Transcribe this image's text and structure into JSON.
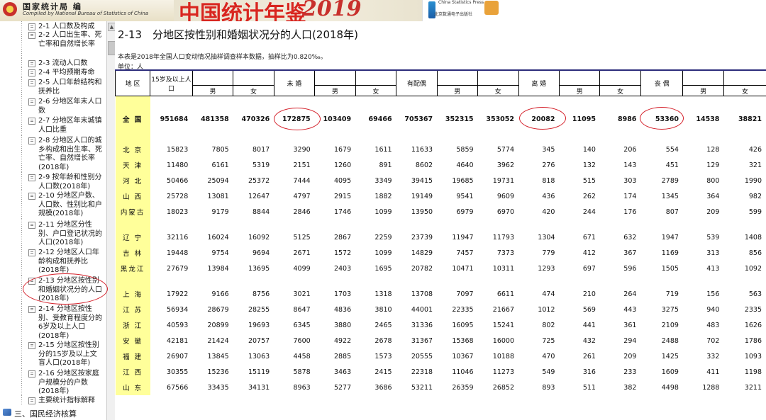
{
  "header": {
    "org_cn": "国家统计局 编",
    "org_en": "Compiled by National Bureau of Statistics of China",
    "book_title": "中国统计年鉴",
    "book_year": "2019",
    "press_en": "China Statistics Press",
    "press_cn": "北京数通电子出版社"
  },
  "sidebar": {
    "items": [
      {
        "label": "2-1 人口数及构成"
      },
      {
        "label": "2-2 人口出生率、死亡率和自然增长率"
      },
      {
        "label": "2-3 流动人口数"
      },
      {
        "label": "2-4 平均预期寿命"
      },
      {
        "label": "2-5 人口年龄结构和抚养比"
      },
      {
        "label": "2-6 分地区年末人口数"
      },
      {
        "label": "2-7 分地区年末城镇人口比重"
      },
      {
        "label": "2-8 分地区人口的城乡构成和出生率、死亡率、自然增长率(2018年)"
      },
      {
        "label": "2-9 按年龄和性别分人口数(2018年)"
      },
      {
        "label": "2-10 分地区户数、人口数、性别比和户规模(2018年)"
      },
      {
        "label": "2-11 分地区分性别、户口登记状况的人口(2018年)"
      },
      {
        "label": "2-12 分地区人口年龄构成和抚养比(2018年)"
      },
      {
        "label": "2-13 分地区按性别和婚姻状况分的人口(2018年)"
      },
      {
        "label": "2-14 分地区按性别、受教育程度分的6岁及以上人口(2018年)"
      },
      {
        "label": "2-15 分地区按性别分的15岁及以上文盲人口(2018年)"
      },
      {
        "label": "2-16 分地区按家庭户规模分的户数(2018年)"
      },
      {
        "label": "主要统计指标解释"
      }
    ],
    "footer": "三、国民经济核算"
  },
  "main": {
    "title": "2-13　分地区按性别和婚姻状况分的人口(2018年)",
    "note": "本表是2018年全国人口变动情况抽样调查样本数据，抽样比为0.820‰。",
    "unit": "单位：人",
    "headers": {
      "region": "地 区",
      "pop15": "15岁及以上人口",
      "unmarried": "未 婚",
      "married": "有配偶",
      "divorced": "离 婚",
      "widowed": "丧 偶",
      "male": "男",
      "female": "女"
    },
    "total": {
      "region": "全 国",
      "values": [
        "951684",
        "481358",
        "470326",
        "172875",
        "103409",
        "69466",
        "705367",
        "352315",
        "353052",
        "20082",
        "11095",
        "8986",
        "53360",
        "14538",
        "38821"
      ]
    },
    "groups": [
      [
        {
          "region": "北 京",
          "values": [
            "15823",
            "7805",
            "8017",
            "3290",
            "1679",
            "1611",
            "11633",
            "5859",
            "5774",
            "345",
            "140",
            "206",
            "554",
            "128",
            "426"
          ]
        },
        {
          "region": "天 津",
          "values": [
            "11480",
            "6161",
            "5319",
            "2151",
            "1260",
            "891",
            "8602",
            "4640",
            "3962",
            "276",
            "132",
            "143",
            "451",
            "129",
            "321"
          ]
        },
        {
          "region": "河 北",
          "values": [
            "50466",
            "25094",
            "25372",
            "7444",
            "4095",
            "3349",
            "39415",
            "19685",
            "19731",
            "818",
            "515",
            "303",
            "2789",
            "800",
            "1990"
          ]
        },
        {
          "region": "山 西",
          "values": [
            "25728",
            "13081",
            "12647",
            "4797",
            "2915",
            "1882",
            "19149",
            "9541",
            "9609",
            "436",
            "262",
            "174",
            "1345",
            "364",
            "982"
          ]
        },
        {
          "region": "内蒙古",
          "values": [
            "18023",
            "9179",
            "8844",
            "2846",
            "1746",
            "1099",
            "13950",
            "6979",
            "6970",
            "420",
            "244",
            "176",
            "807",
            "209",
            "599"
          ]
        }
      ],
      [
        {
          "region": "辽 宁",
          "values": [
            "32116",
            "16024",
            "16092",
            "5125",
            "2867",
            "2259",
            "23739",
            "11947",
            "11793",
            "1304",
            "671",
            "632",
            "1947",
            "539",
            "1408"
          ]
        },
        {
          "region": "吉 林",
          "values": [
            "19448",
            "9754",
            "9694",
            "2671",
            "1572",
            "1099",
            "14829",
            "7457",
            "7373",
            "779",
            "412",
            "367",
            "1169",
            "313",
            "856"
          ]
        },
        {
          "region": "黑龙江",
          "values": [
            "27679",
            "13984",
            "13695",
            "4099",
            "2403",
            "1695",
            "20782",
            "10471",
            "10311",
            "1293",
            "697",
            "596",
            "1505",
            "413",
            "1092"
          ]
        }
      ],
      [
        {
          "region": "上 海",
          "values": [
            "17922",
            "9166",
            "8756",
            "3021",
            "1703",
            "1318",
            "13708",
            "7097",
            "6611",
            "474",
            "210",
            "264",
            "719",
            "156",
            "563"
          ]
        },
        {
          "region": "江 苏",
          "values": [
            "56934",
            "28679",
            "28255",
            "8647",
            "4836",
            "3810",
            "44001",
            "22335",
            "21667",
            "1012",
            "569",
            "443",
            "3275",
            "940",
            "2335"
          ]
        },
        {
          "region": "浙 江",
          "values": [
            "40593",
            "20899",
            "19693",
            "6345",
            "3880",
            "2465",
            "31336",
            "16095",
            "15241",
            "802",
            "441",
            "361",
            "2109",
            "483",
            "1626"
          ]
        },
        {
          "region": "安 徽",
          "values": [
            "42181",
            "21424",
            "20757",
            "7600",
            "4922",
            "2678",
            "31367",
            "15368",
            "16000",
            "725",
            "432",
            "294",
            "2488",
            "702",
            "1786"
          ]
        },
        {
          "region": "福 建",
          "values": [
            "26907",
            "13845",
            "13063",
            "4458",
            "2885",
            "1573",
            "20555",
            "10367",
            "10188",
            "470",
            "261",
            "209",
            "1425",
            "332",
            "1093"
          ]
        },
        {
          "region": "江 西",
          "values": [
            "30355",
            "15236",
            "15119",
            "5878",
            "3463",
            "2415",
            "22318",
            "11046",
            "11273",
            "549",
            "316",
            "233",
            "1609",
            "411",
            "1198"
          ]
        },
        {
          "region": "山 东",
          "values": [
            "67566",
            "33435",
            "34131",
            "8963",
            "5277",
            "3686",
            "53211",
            "26359",
            "26852",
            "893",
            "511",
            "382",
            "4498",
            "1288",
            "3211"
          ]
        }
      ]
    ]
  }
}
